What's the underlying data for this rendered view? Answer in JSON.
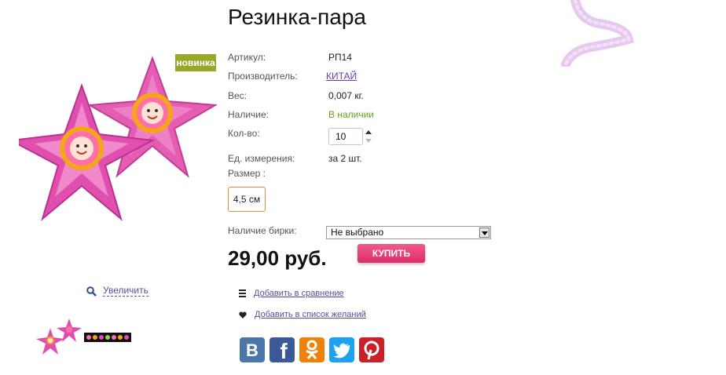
{
  "product": {
    "title": "Резинка-пара",
    "badge": "новинка",
    "zoom_label": "Увеличить"
  },
  "props": {
    "article_label": "Артикул:",
    "article_value": "РП14",
    "maker_label": "Производитель:",
    "maker_value": "КИТАЙ",
    "weight_label": "Вес:",
    "weight_value": "0,007 кг.",
    "availability_label": "Наличие:",
    "availability_value": "В наличии",
    "qty_label": "Кол-во:",
    "qty_value": "10",
    "unit_label": "Ед. измерения:",
    "unit_value": "за 2 шт.",
    "size_label": "Размер :",
    "size_option": "4,5 см",
    "tag_label": "Наличие бирки:",
    "tag_select": "Не выбрано"
  },
  "price": "29,00 руб.",
  "buy_label": "КУПИТЬ",
  "actions": {
    "compare_label": "Добавить в сравнение",
    "wishlist_label": " Добавить в список желаний"
  },
  "social": [
    {
      "icon": "vk-icon",
      "letter": "B",
      "color": "#4a76a8"
    },
    {
      "icon": "facebook-icon",
      "letter": "f",
      "color": "#3b5998"
    },
    {
      "icon": "odnoklassniki-icon",
      "letter": "ok",
      "color": "#ee8208"
    },
    {
      "icon": "twitter-icon",
      "letter": "t",
      "color": "#1da1f2"
    },
    {
      "icon": "pinterest-icon",
      "letter": "P",
      "color": "#cb2027"
    }
  ],
  "colors": {
    "badge": "#9aa82a",
    "buy": "#e33b74",
    "link": "#5b4a9a",
    "available": "#6e9c1d"
  }
}
